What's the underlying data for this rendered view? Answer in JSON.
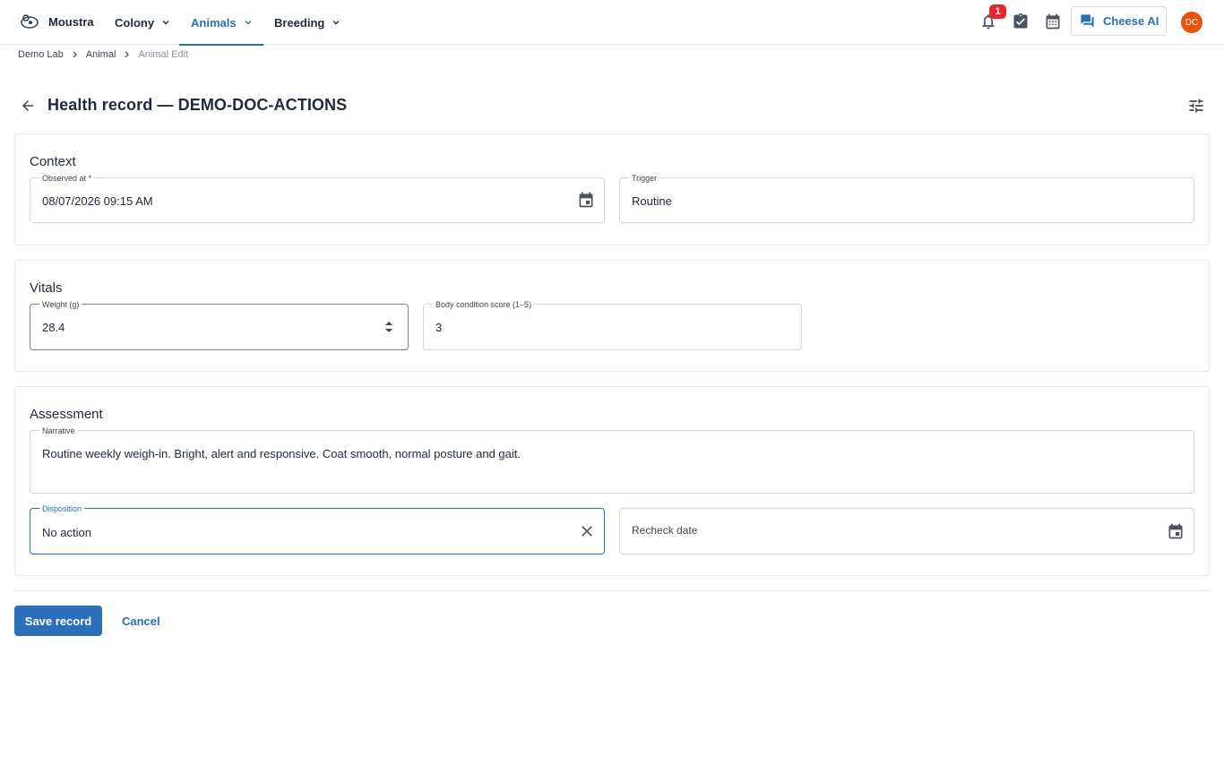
{
  "app": {
    "name": "Moustra"
  },
  "nav": {
    "colony": "Colony",
    "animals": "Animals",
    "breeding": "Breeding"
  },
  "header": {
    "notification_count": "1",
    "ai_label": "Cheese AI",
    "avatar_initials": "DC"
  },
  "breadcrumb": [
    "Demo Lab",
    "Animal",
    "Animal Edit"
  ],
  "page": {
    "title": "Health record — DEMO-DOC-ACTIONS"
  },
  "context": {
    "title": "Context",
    "observed_label": "Observed at *",
    "observed_value": "08/07/2026 09:15 AM",
    "trigger_label": "Trigger",
    "trigger_value": "Routine"
  },
  "vitals": {
    "title": "Vitals",
    "weight_label": "Weight (g)",
    "weight_value": "28.4",
    "bcs_label": "Body condition score (1–5)",
    "bcs_value": "3"
  },
  "assessment": {
    "title": "Assessment",
    "narrative_label": "Narrative",
    "narrative_value": "Routine weekly weigh-in. Bright, alert and responsive. Coat smooth, normal posture and gait.",
    "disposition_label": "Disposition",
    "disposition_value": "No action",
    "recheck_placeholder": "Recheck date"
  },
  "actions": {
    "save": "Save record",
    "cancel": "Cancel"
  },
  "colors": {
    "accent": "#2a6fb8",
    "badge": "#e5262e",
    "avatar": "#e4540f"
  }
}
